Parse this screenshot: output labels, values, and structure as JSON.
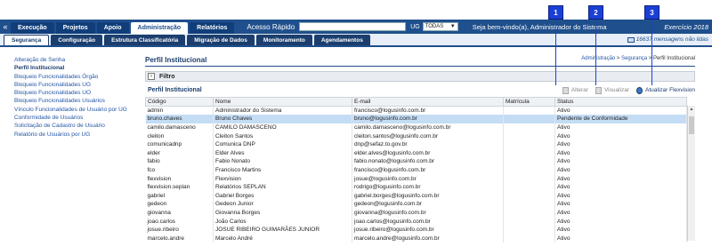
{
  "topbar": {
    "tabs": [
      "Execução",
      "Projetos",
      "Apoio",
      "Administração",
      "Relatórios"
    ],
    "active_tab": "Administração",
    "quick_access_label": "Acesso Rápido",
    "ug_label": "UG",
    "ug_value": "TODAS",
    "welcome": "Seja bem-vindo(a), Administrador do Sistema",
    "year": "Exercício 2018"
  },
  "subbar": {
    "tabs": [
      "Segurança",
      "Configuração",
      "Estrutura Classificatória",
      "Migração de Dados",
      "Monitoramento",
      "Agendamentos"
    ],
    "messages": "16637 mensagens não lidas"
  },
  "leftnav": [
    "Alteração de Senha",
    "Perfil Institucional",
    "Bloqueio Funcionalidades Órgão",
    "Bloqueio Funcionalidades UG",
    "Bloqueio Funcionalidades UO",
    "Bloqueio Funcionalidades Usuários",
    "Vínculo Funcionalidades de Usuário por UG",
    "Conformidade de Usuários",
    "Solicitação de Cadastro de Usuário",
    "Relatório de Usuários por UG"
  ],
  "main": {
    "title": "Perfil Institucional",
    "breadcrumb": [
      "Administração",
      "Segurança",
      "Perfil Institucional"
    ],
    "filter_label": "Filtro",
    "panel_title": "Perfil Institucional",
    "actions": [
      "Alterar",
      "Visualizar",
      "Atualizar Flexvision"
    ]
  },
  "markers": [
    "1",
    "2",
    "3"
  ],
  "table": {
    "columns": [
      "Código",
      "Nome",
      "E-mail",
      "Matrícula",
      "Status"
    ],
    "rows": [
      [
        "admin",
        "Administrador do Sistema",
        "francisco@logusinfo.com.br",
        "",
        "Ativo"
      ],
      [
        "bruno.chaves",
        "Bruno Chaves",
        "bruno@logusinfo.com.br",
        "",
        "Pendente de Conformidade"
      ],
      [
        "camilo.damasceno",
        "CAMILO DAMASCENO",
        "camilo.damasceno@logusinfo.com.br",
        "",
        "Ativo"
      ],
      [
        "cleiton",
        "Cleiton Santos",
        "cleiton.santos@logusinfo.com.br",
        "",
        "Ativo"
      ],
      [
        "comunicadnp",
        "Comunica DNP",
        "dnp@sefaz.to.gov.br",
        "",
        "Ativo"
      ],
      [
        "elder",
        "Elder Alves",
        "elder.alves@logusinfo.com.br",
        "",
        "Ativo"
      ],
      [
        "fabio",
        "Fabio Nonato",
        "fabio.nonato@logusinfo.com.br",
        "",
        "Ativo"
      ],
      [
        "fco",
        "Francisco Martins",
        "francisco@logusinfo.com.br",
        "",
        "Ativo"
      ],
      [
        "flexvision",
        "Flexvision",
        "josue@logusinfo.com.br",
        "",
        "Ativo"
      ],
      [
        "flexvision.seplan",
        "Relatórios SEPLAN",
        "rodrigo@logusinfo.com.br",
        "",
        "Ativo"
      ],
      [
        "gabriel",
        "Gabriel Borges",
        "gabriel.borges@logusinfo.com.br",
        "",
        "Ativo"
      ],
      [
        "gedeon",
        "Gedeon Junior",
        "gedeon@logusinfo.com.br",
        "",
        "Ativo"
      ],
      [
        "giovanna",
        "Giovanna Borges",
        "giovanna@logusinfo.com.br",
        "",
        "Ativo"
      ],
      [
        "joao.carlos",
        "João Carlos",
        "joao.carlos@logusinfo.com.br",
        "",
        "Ativo"
      ],
      [
        "josue.ribeiro",
        "JOSUE RIBEIRO GUIMARÃES JUNIOR",
        "josue.ribeiro@logusinfo.com.br",
        "",
        "Ativo"
      ],
      [
        "marcelo.andre",
        "Marcelo André",
        "marcelo.andre@logusinfo.com.br",
        "",
        "Ativo"
      ]
    ],
    "selected_row": 1
  }
}
